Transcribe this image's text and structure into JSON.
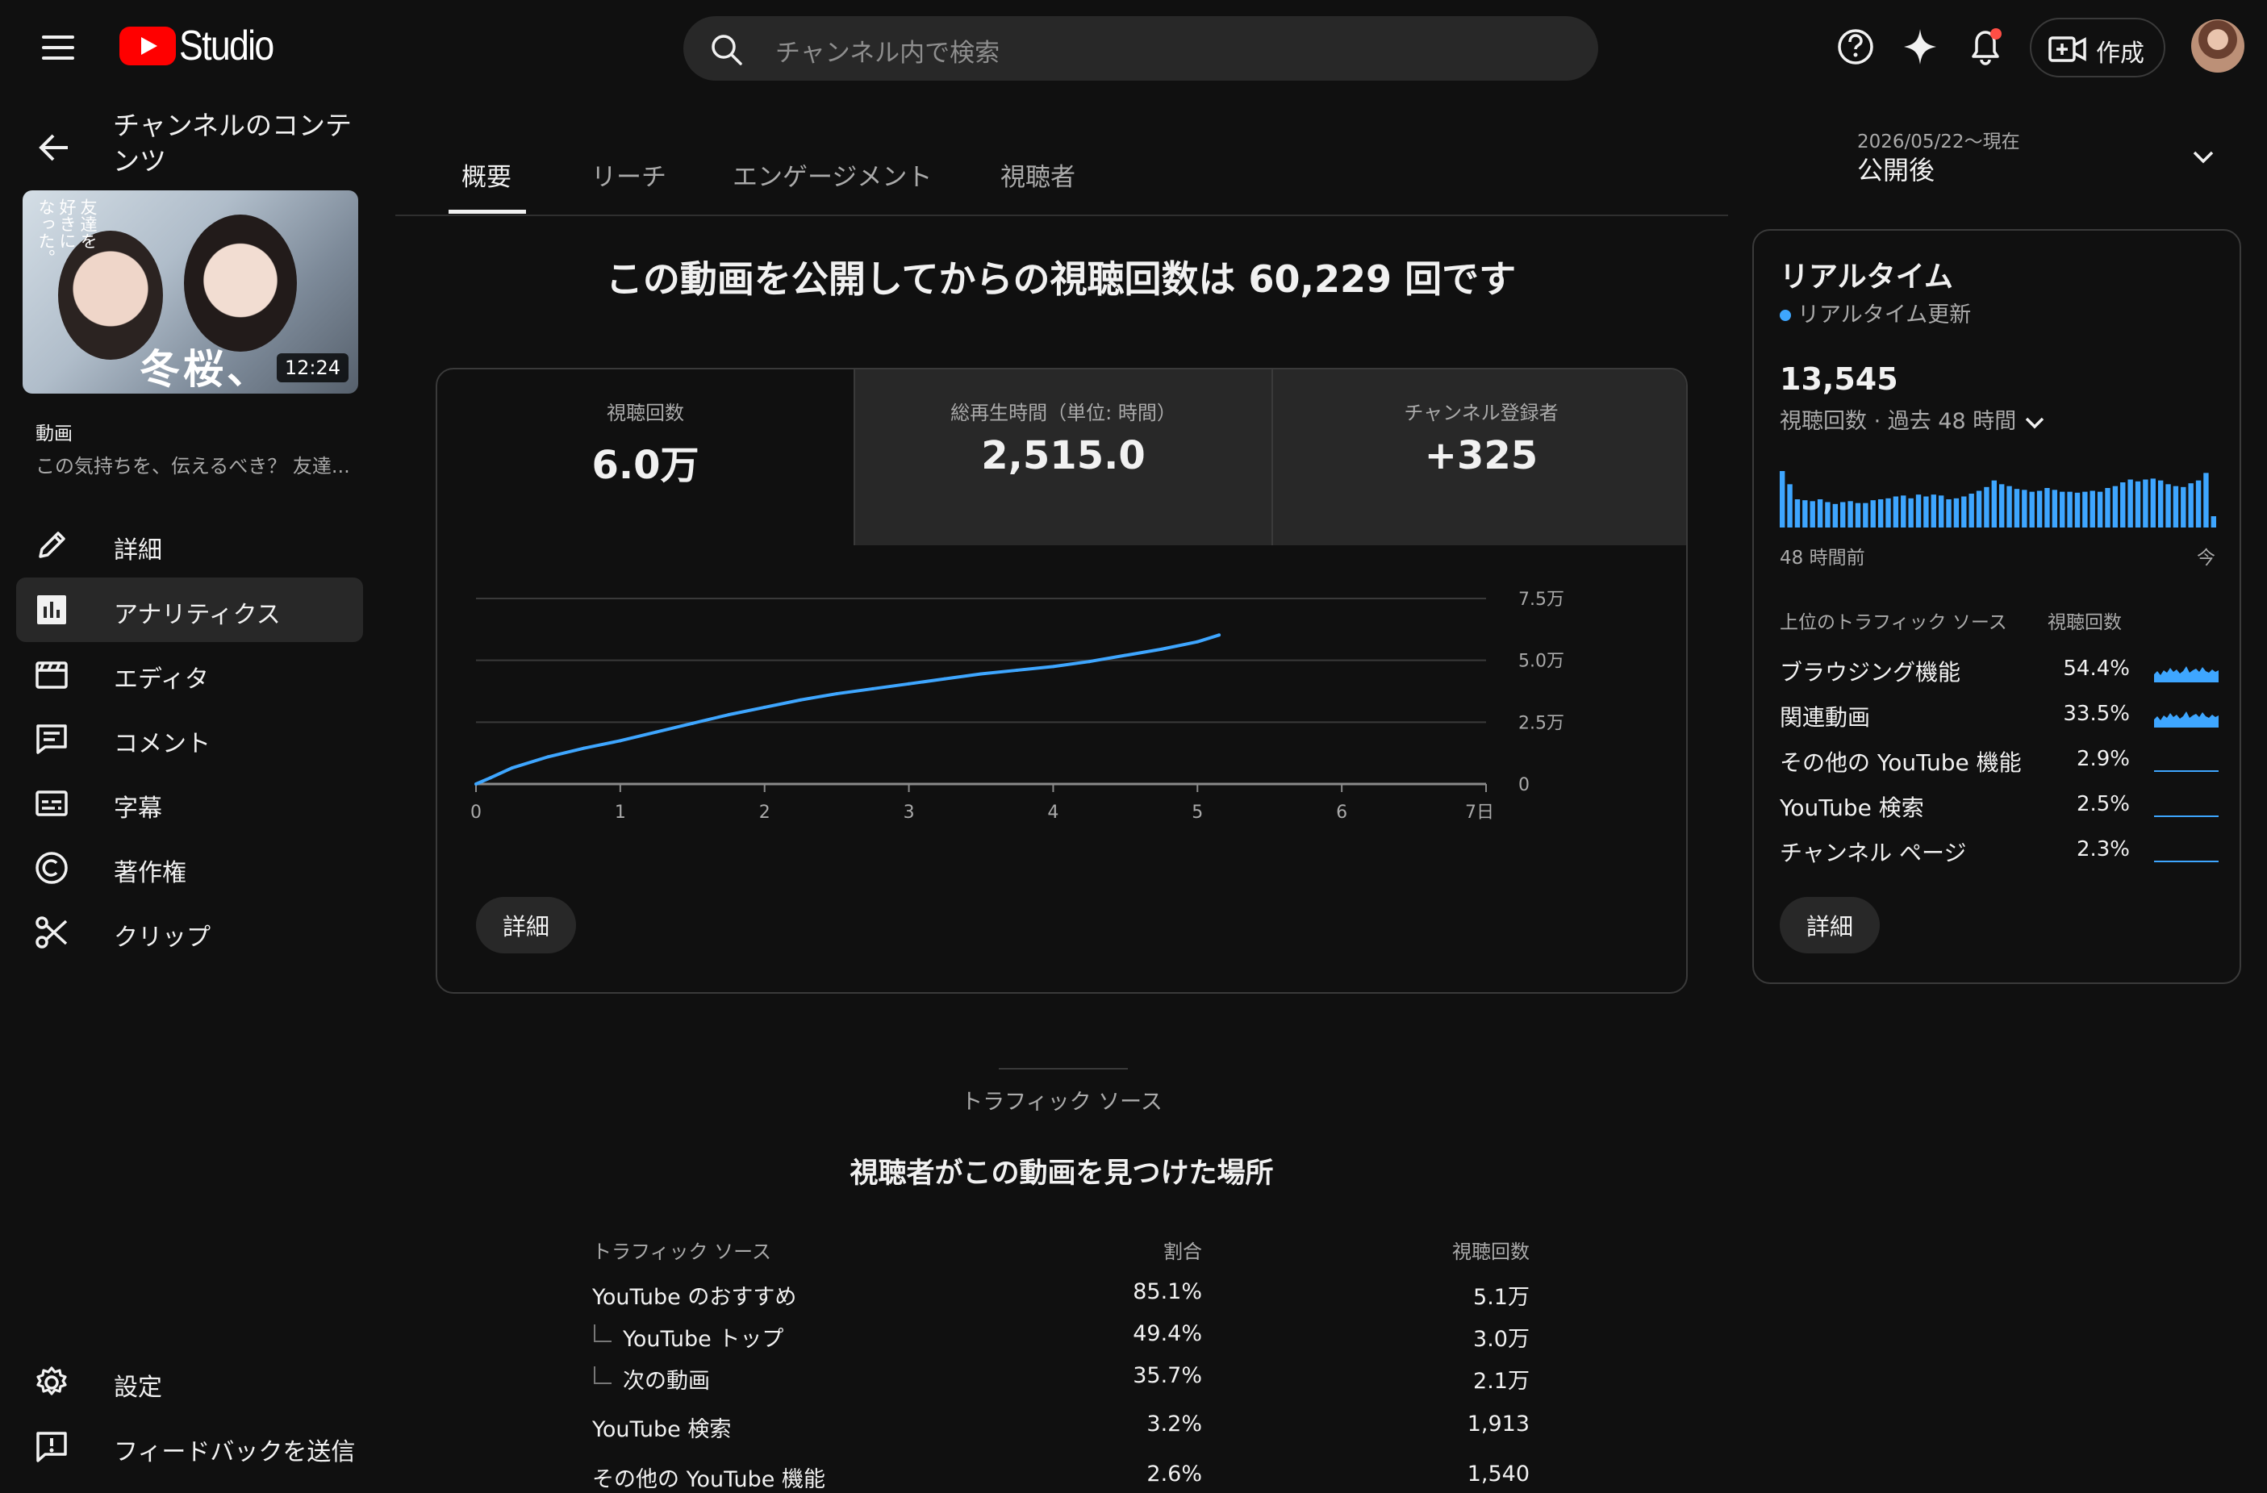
{
  "header": {
    "logo_text": "Studio",
    "search_placeholder": "チャンネル内で検索",
    "create_label": "作成"
  },
  "sidebar": {
    "title": "チャンネルのコンテンツ",
    "thumbnail": {
      "duration": "12:24",
      "overlay_title": "冬桜、",
      "vertical_text": [
        "友達を",
        "好きに",
        "なった。"
      ]
    },
    "video_label": "動画",
    "video_desc": "この気持ちを、伝えるべき？ 友達...",
    "items": [
      {
        "label": "詳細",
        "icon": "pencil-icon"
      },
      {
        "label": "アナリティクス",
        "icon": "analytics-icon",
        "active": true
      },
      {
        "label": "エディタ",
        "icon": "clapperboard-icon"
      },
      {
        "label": "コメント",
        "icon": "comment-icon"
      },
      {
        "label": "字幕",
        "icon": "subtitles-icon"
      },
      {
        "label": "著作権",
        "icon": "copyright-icon"
      },
      {
        "label": "クリップ",
        "icon": "scissors-icon"
      }
    ],
    "bottom": [
      {
        "label": "設定",
        "icon": "gear-icon"
      },
      {
        "label": "フィードバックを送信",
        "icon": "feedback-icon"
      }
    ]
  },
  "tabs": [
    "概要",
    "リーチ",
    "エンゲージメント",
    "視聴者"
  ],
  "date_range": {
    "sub": "2026/05/22～現在",
    "main": "公開後"
  },
  "headline": "この動画を公開してからの視聴回数は 60,229 回です",
  "stats": [
    {
      "label": "視聴回数",
      "value": "6.0万"
    },
    {
      "label": "総再生時間（単位: 時間）",
      "value": "2,515.0"
    },
    {
      "label": "チャンネル登録者",
      "value": "+325"
    }
  ],
  "chart_data": {
    "type": "line",
    "title": "",
    "xlabel": "",
    "ylabel": "",
    "x_ticks": [
      "0",
      "1",
      "2",
      "3",
      "4",
      "5",
      "6",
      "7日"
    ],
    "y_ticks": [
      "0",
      "2.5万",
      "5.0万",
      "7.5万"
    ],
    "xlim": [
      0,
      7
    ],
    "ylim": [
      0,
      75000
    ],
    "grid": true,
    "color": "#3ea6ff",
    "x": [
      0,
      0.1,
      0.25,
      0.5,
      0.75,
      1,
      1.25,
      1.5,
      1.75,
      2,
      2.25,
      2.5,
      2.75,
      3,
      3.25,
      3.5,
      3.75,
      4,
      4.25,
      4.5,
      4.75,
      5,
      5.15
    ],
    "y": [
      0,
      2500,
      6500,
      11000,
      14500,
      17500,
      21000,
      24500,
      28000,
      31000,
      34000,
      36500,
      38500,
      40500,
      42500,
      44500,
      46000,
      47500,
      49500,
      52000,
      54500,
      57500,
      60229
    ]
  },
  "detail_label": "詳細",
  "realtime": {
    "title": "リアルタイム",
    "live_label": "リアルタイム更新",
    "value": "13,545",
    "sub": "視聴回数 · 過去 48 時間",
    "axis_start": "48 時間前",
    "axis_end": "今",
    "bars": [
      60,
      46,
      30,
      29,
      28,
      30,
      27,
      25,
      27,
      28,
      26,
      26,
      29,
      30,
      31,
      33,
      34,
      31,
      35,
      33,
      35,
      34,
      30,
      31,
      33,
      36,
      39,
      43,
      50,
      46,
      44,
      41,
      40,
      38,
      39,
      42,
      40,
      38,
      38,
      37,
      38,
      39,
      38,
      42,
      44,
      48,
      51,
      49,
      51,
      52,
      50,
      46,
      44,
      43,
      47,
      50,
      58,
      12
    ],
    "table_header": [
      "上位のトラフィック ソース",
      "視聴回数"
    ],
    "sources": [
      {
        "name": "ブラウジング機能",
        "pct": "54.4%",
        "spark": "busy"
      },
      {
        "name": "関連動画",
        "pct": "33.5%",
        "spark": "busy"
      },
      {
        "name": "その他の YouTube 機能",
        "pct": "2.9%",
        "spark": "flat"
      },
      {
        "name": "YouTube 検索",
        "pct": "2.5%",
        "spark": "flat"
      },
      {
        "name": "チャンネル ページ",
        "pct": "2.3%",
        "spark": "flat"
      }
    ]
  },
  "traffic": {
    "section": "トラフィック ソース",
    "title": "視聴者がこの動画を見つけた場所",
    "headers": [
      "トラフィック ソース",
      "割合",
      "視聴回数"
    ],
    "rows": [
      {
        "name": "YouTube のおすすめ",
        "pct": "85.1%",
        "views": "5.1万"
      },
      {
        "name": "YouTube トップ",
        "pct": "49.4%",
        "views": "3.0万",
        "sub": true
      },
      {
        "name": "次の動画",
        "pct": "35.7%",
        "views": "2.1万",
        "sub": true
      },
      {
        "name": "YouTube 検索",
        "pct": "3.2%",
        "views": "1,913"
      },
      {
        "name": "その他の YouTube 機能",
        "pct": "2.6%",
        "views": "1,540"
      }
    ]
  }
}
